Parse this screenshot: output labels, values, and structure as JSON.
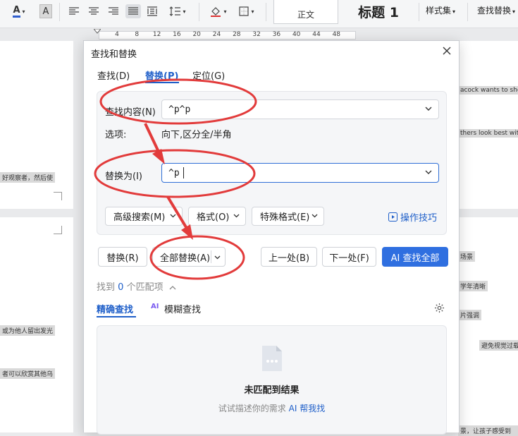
{
  "toolbar": {
    "font_color_glyph": "A",
    "font_shade_glyph": "A",
    "style_normal": "正文",
    "style_heading": "标题 1",
    "style_set": "样式集",
    "find_replace": "查找替换"
  },
  "ruler": {
    "numbers": [
      "4",
      "8",
      "12",
      "16",
      "20",
      "24",
      "28",
      "32",
      "36",
      "40",
      "44",
      "48"
    ]
  },
  "document": {
    "snippets_left": [
      "好观察者，然后使",
      "或为他人留出发光",
      "者可以欣赏其他乌"
    ],
    "snippets_right": [
      "acock wants to show it",
      "thers look best with hu",
      "场景",
      "学年清晰",
      "片强调",
      "避免视觉过载",
      "景，让孩子感受到"
    ]
  },
  "dialog": {
    "title": "查找和替换",
    "tabs": [
      "查找(D)",
      "替换(P)",
      "定位(G)"
    ],
    "find_label": "查找内容(N)",
    "find_value": "^p^p",
    "options_label": "选项:",
    "options_value": "向下,区分全/半角",
    "replace_label": "替换为(I)",
    "replace_value": "^p",
    "advanced_search": "高级搜索(M)",
    "format": "格式(O)",
    "special_format": "特殊格式(E)",
    "tips": "操作技巧",
    "btn_replace": "替换(R)",
    "btn_replace_all": "全部替换(A)",
    "btn_prev": "上一处(B)",
    "btn_next": "下一处(F)",
    "btn_ai_find_all": "AI 查找全部",
    "match_prefix": "找到",
    "match_count": "0",
    "match_suffix": "个匹配项",
    "subtab_exact": "精确查找",
    "subtab_fuzzy": "模糊查找",
    "ai_badge": "AI",
    "no_result_title": "未匹配到结果",
    "no_result_hint": "试试描述你的需求",
    "no_result_link": "AI 帮我找"
  },
  "colors": {
    "accent": "#1f5fc9",
    "primary_button": "#2f6fe0",
    "annotation": "#e23b3b"
  }
}
